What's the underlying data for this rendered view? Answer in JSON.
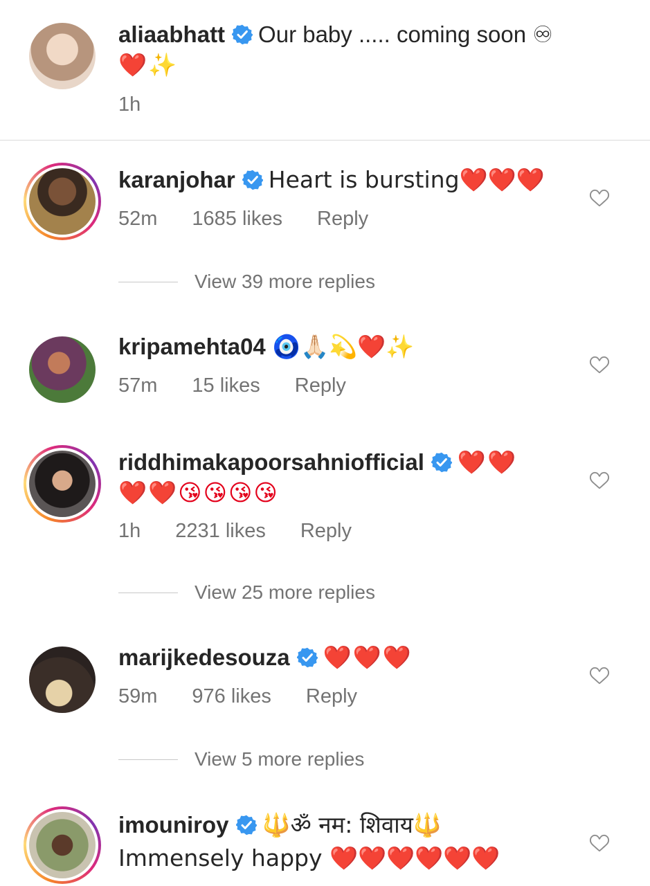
{
  "caption": {
    "username": "aliaabhatt",
    "text": "Our baby ..... coming soon ♾",
    "text2": "❤️✨",
    "time": "1h"
  },
  "comments": [
    {
      "username": "karanjohar",
      "verified": true,
      "text": "Heart is bursting❤️❤️❤️",
      "time": "52m",
      "likes": "1685 likes",
      "reply": "Reply",
      "view_replies": "View 39 more replies"
    },
    {
      "username": "kripamehta04",
      "verified": false,
      "text": "🧿🙏🏻💫❤️✨",
      "time": "57m",
      "likes": "15 likes",
      "reply": "Reply"
    },
    {
      "username": "riddhimakapoorsahniofficial",
      "verified": true,
      "text": "❤️❤️",
      "text2": "❤️❤️😘😘😘😘",
      "time": "1h",
      "likes": "2231 likes",
      "reply": "Reply",
      "view_replies": "View 25 more replies"
    },
    {
      "username": "marijkedesouza",
      "verified": true,
      "text": "❤️❤️❤️",
      "time": "59m",
      "likes": "976 likes",
      "reply": "Reply",
      "view_replies": "View 5 more replies"
    },
    {
      "username": "imouniroy",
      "verified": true,
      "text": "🔱ॐ नम: शिवाय🔱",
      "text2": "Immensely happy ❤️❤️❤️❤️❤️❤️"
    }
  ],
  "icons": {
    "verified": "verified-badge-icon",
    "like": "heart-outline-icon"
  },
  "colors": {
    "verified": "#3897f0",
    "muted": "#737373",
    "text": "#262626"
  }
}
